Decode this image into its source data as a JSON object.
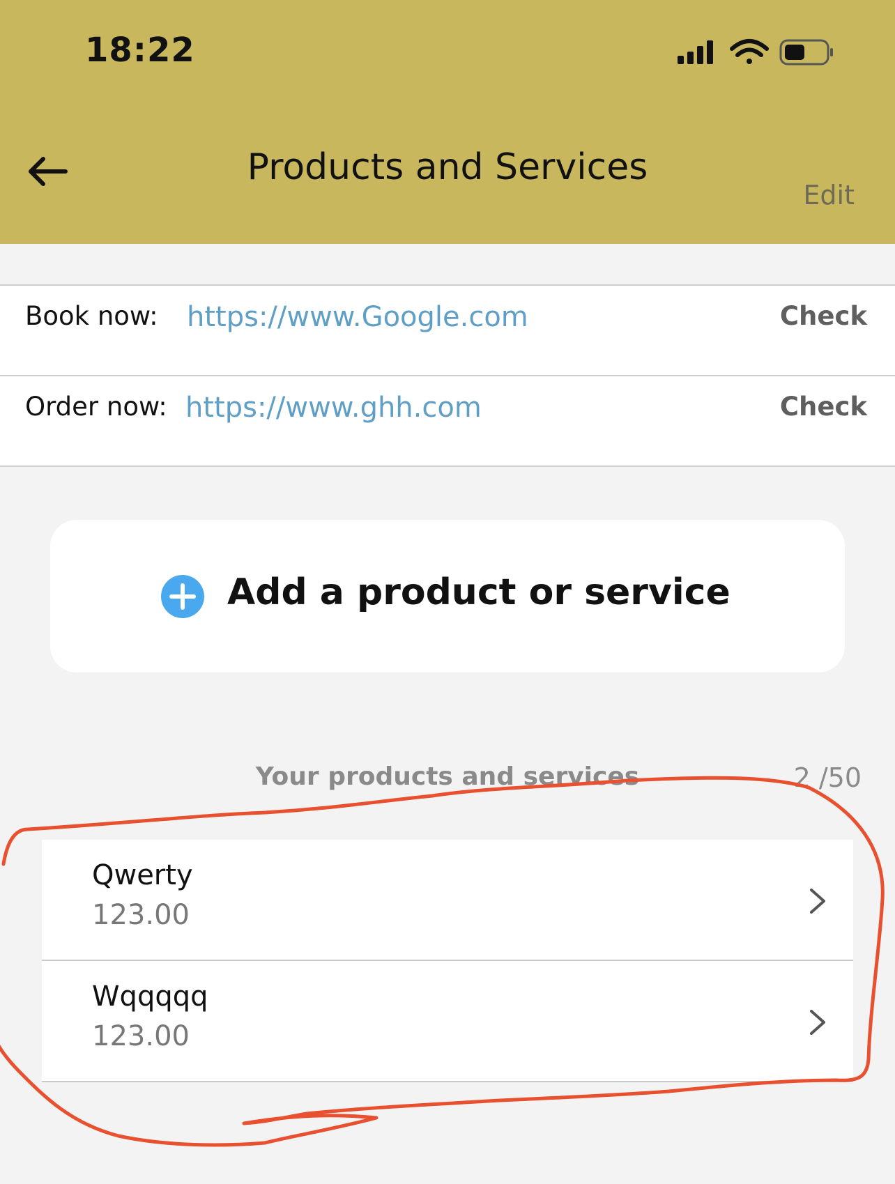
{
  "status_bar": {
    "time": "18:22",
    "icons": [
      "signal-icon",
      "wifi-icon",
      "battery-icon"
    ]
  },
  "header": {
    "title": "Products and Services",
    "edit_label": "Edit",
    "back_icon": "back-arrow-icon",
    "background_color": "#c8b75c"
  },
  "links": [
    {
      "label": "Book now:",
      "url": "https://www.Google.com",
      "action": "Check"
    },
    {
      "label": "Order now:",
      "url": "https://www.ghh.com",
      "action": "Check"
    }
  ],
  "add_button": {
    "label": "Add a product or service",
    "icon": "plus-circle-icon",
    "icon_color": "#4aa8ee"
  },
  "products_section": {
    "title": "Your products and services",
    "count": "2 /50",
    "items": [
      {
        "name": "Qwerty",
        "price": "123.00"
      },
      {
        "name": "Wqqqqq",
        "price": "123.00"
      }
    ]
  },
  "colors": {
    "link": "#5f9fc6",
    "annotation": "#e8502f",
    "page_background": "#f3f3f3"
  }
}
